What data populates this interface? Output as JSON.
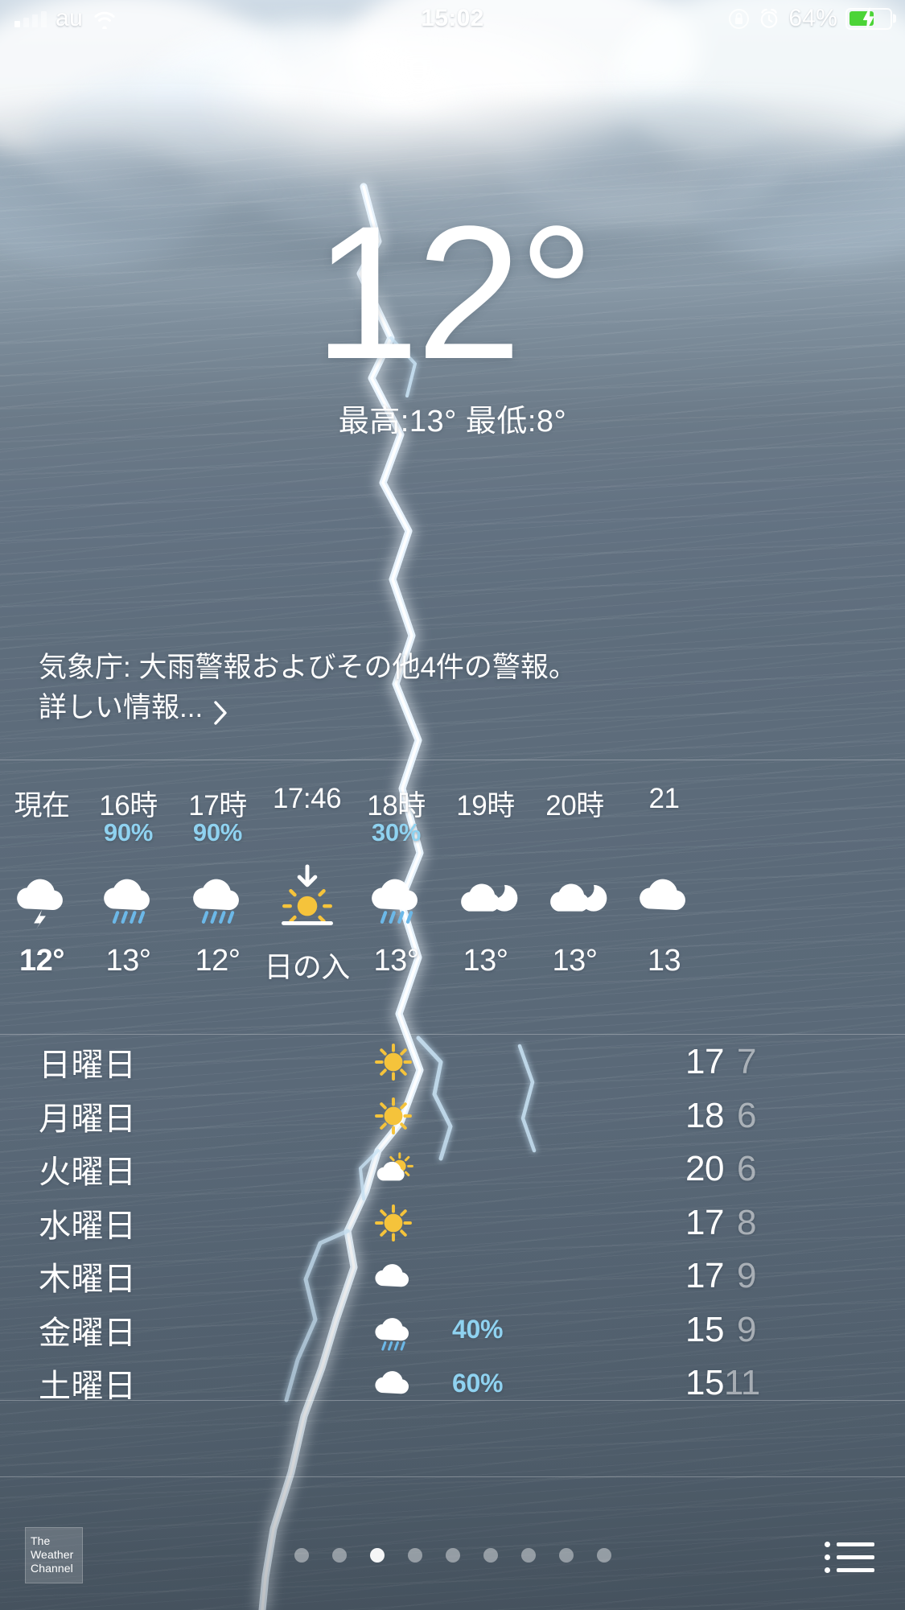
{
  "status_bar": {
    "carrier": "au",
    "time": "15:02",
    "battery_percent": "64%",
    "signal_icon": "signal-bars-icon",
    "wifi_icon": "wifi-icon",
    "rotation_lock_icon": "rotation-lock-icon",
    "alarm_icon": "alarm-clock-icon",
    "battery_icon": "battery-charging-icon",
    "battery_fill_color": "#4cd437"
  },
  "current": {
    "temperature": "12°",
    "high_low": "最高:13° 最低:8°"
  },
  "alert": {
    "line1": "気象庁: 大雨警報およびその他4件の警報。",
    "more_label": "詳しい情報...",
    "chevron_icon": "chevron-right-icon"
  },
  "hourly": {
    "accent_color": "#8fd2f0",
    "items": [
      {
        "label": "現在",
        "pop": "",
        "icon": "thunderstorm-icon",
        "temp": "12°",
        "bold": true,
        "word": false
      },
      {
        "label": "16時",
        "pop": "90%",
        "icon": "rain-icon",
        "temp": "13°",
        "bold": false,
        "word": false
      },
      {
        "label": "17時",
        "pop": "90%",
        "icon": "rain-icon",
        "temp": "12°",
        "bold": false,
        "word": false
      },
      {
        "label": "17:46",
        "pop": "",
        "icon": "sunset-icon",
        "temp": "日の入",
        "bold": false,
        "word": true
      },
      {
        "label": "18時",
        "pop": "30%",
        "icon": "rain-icon",
        "temp": "13°",
        "bold": false,
        "word": false
      },
      {
        "label": "19時",
        "pop": "",
        "icon": "partly-cloudy-night-icon",
        "temp": "13°",
        "bold": false,
        "word": false
      },
      {
        "label": "20時",
        "pop": "",
        "icon": "partly-cloudy-night-icon",
        "temp": "13°",
        "bold": false,
        "word": false
      },
      {
        "label": "21",
        "pop": "",
        "icon": "cloud-icon",
        "temp": "13",
        "bold": false,
        "word": false
      }
    ]
  },
  "daily": {
    "rows": [
      {
        "day": "日曜日",
        "icon": "sunny-icon",
        "pop": "",
        "high": "17",
        "low": "7"
      },
      {
        "day": "月曜日",
        "icon": "sunny-icon",
        "pop": "",
        "high": "18",
        "low": "6"
      },
      {
        "day": "火曜日",
        "icon": "partly-cloudy-icon",
        "pop": "",
        "high": "20",
        "low": "6"
      },
      {
        "day": "水曜日",
        "icon": "sunny-icon",
        "pop": "",
        "high": "17",
        "low": "8"
      },
      {
        "day": "木曜日",
        "icon": "cloud-icon",
        "pop": "",
        "high": "17",
        "low": "9"
      },
      {
        "day": "金曜日",
        "icon": "rain-icon",
        "pop": "40%",
        "high": "15",
        "low": "9"
      },
      {
        "day": "土曜日",
        "icon": "cloud-icon",
        "pop": "60%",
        "high": "15",
        "low": "11"
      }
    ]
  },
  "bottom": {
    "logo_line1": "The",
    "logo_line2": "Weather",
    "logo_line3": "Channel",
    "page_count": 9,
    "active_page": 3,
    "list_button_icon": "list-icon"
  }
}
